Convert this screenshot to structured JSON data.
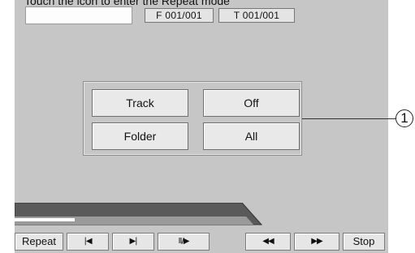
{
  "caption": "Touch the icon to enter the Repeat mode",
  "header": {
    "name_display": "",
    "folder_counter": "F 001/001",
    "track_counter": "T 001/001"
  },
  "repeat_menu": {
    "track": "Track",
    "off": "Off",
    "folder": "Folder",
    "all": "All"
  },
  "callout": {
    "number": "1"
  },
  "playback": {
    "progress_fraction": 0.26
  },
  "controls": {
    "repeat": "Repeat",
    "prev": "|◀",
    "next": "▶|",
    "play_pause": "II/▶",
    "rewind": "◀◀",
    "fast_forward": "▶▶",
    "stop": "Stop"
  },
  "icons": {
    "prev": "skip-previous-icon",
    "next": "skip-next-icon",
    "play_pause": "play-pause-icon",
    "rewind": "rewind-icon",
    "fast_forward": "fast-forward-icon"
  },
  "colors": {
    "screen_bg": "#c6c6c6",
    "button_bg": "#e9e9e9",
    "progress_bar": "#5a5a5a",
    "progress_fill": "#ffffff"
  }
}
